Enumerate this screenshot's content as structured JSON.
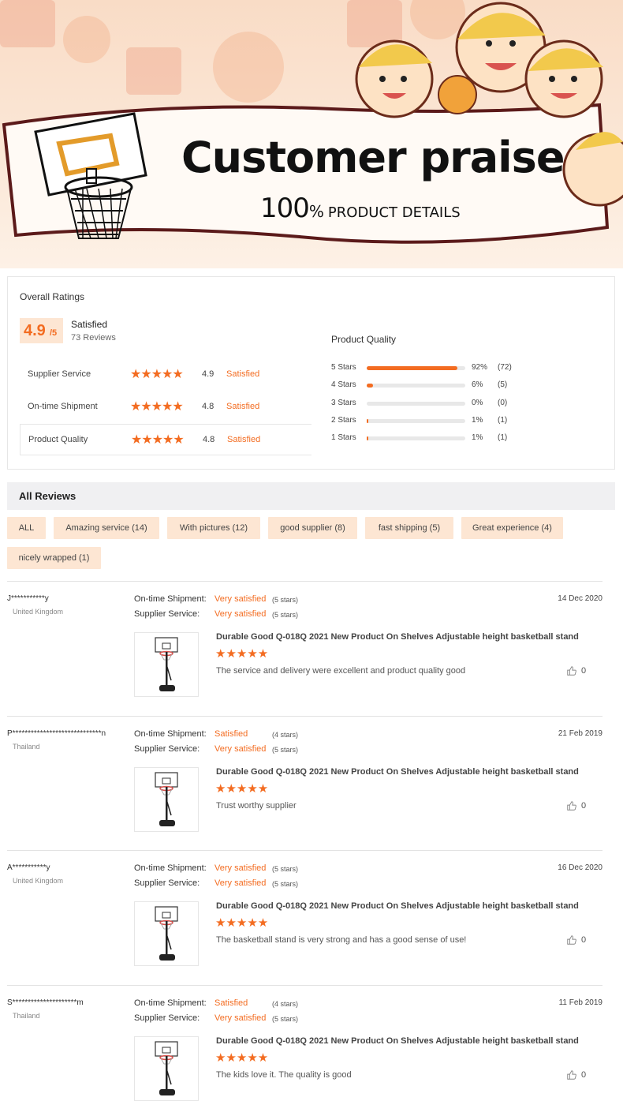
{
  "banner": {
    "title": "Customer praise",
    "percent": "100",
    "percent_sign": "%",
    "subtitle": "PRODUCT DETAILS"
  },
  "ratings": {
    "heading": "Overall Ratings",
    "score": "4.9",
    "score_suffix": "/5",
    "score_label": "Satisfied",
    "review_count": "73 Reviews",
    "rows": [
      {
        "label": "Supplier Service",
        "stars": 5,
        "value": "4.9",
        "word": "Satisfied"
      },
      {
        "label": "On-time Shipment",
        "stars": 5,
        "value": "4.8",
        "word": "Satisfied"
      },
      {
        "label": "Product Quality",
        "stars": 5,
        "value": "4.8",
        "word": "Satisfied"
      }
    ],
    "quality_title": "Product Quality",
    "distribution": [
      {
        "label": "5 Stars",
        "percent": "92%",
        "count": "(72)",
        "fraction": 0.92
      },
      {
        "label": "4 Stars",
        "percent": "6%",
        "count": "(5)",
        "fraction": 0.06
      },
      {
        "label": "3 Stars",
        "percent": "0%",
        "count": "(0)",
        "fraction": 0.0
      },
      {
        "label": "2 Stars",
        "percent": "1%",
        "count": "(1)",
        "fraction": 0.01
      },
      {
        "label": "1 Stars",
        "percent": "1%",
        "count": "(1)",
        "fraction": 0.01
      }
    ]
  },
  "reviews_section": {
    "heading": "All Reviews",
    "filters": [
      "ALL",
      "Amazing service (14)",
      "With pictures (12)",
      "good supplier (8)",
      "fast shipping (5)",
      "Great experience (4)",
      "nicely wrapped (1)"
    ]
  },
  "reviews": [
    {
      "user": "J***********y",
      "country": "United Kingdom",
      "date": "14 Dec 2020",
      "shipment_label": "On-time Shipment:",
      "shipment_value": "Very satisfied",
      "shipment_stars": "(5 stars)",
      "service_label": "Supplier Service:",
      "service_value": "Very satisfied",
      "service_stars": "(5 stars)",
      "product": "Durable Good Q-018Q 2021 New Product On Shelves Adjustable height basketball stand",
      "rating": 5,
      "text": "The service and delivery were excellent and product quality good",
      "likes": "0"
    },
    {
      "user": "P*****************************n",
      "country": "Thailand",
      "date": "21 Feb 2019",
      "shipment_label": "On-time Shipment:",
      "shipment_value": "Satisfied",
      "shipment_stars": "(4 stars)",
      "service_label": "Supplier Service:",
      "service_value": "Very satisfied",
      "service_stars": "(5 stars)",
      "product": "Durable Good Q-018Q 2021 New Product On Shelves Adjustable height basketball stand",
      "rating": 5,
      "text": "Trust worthy supplier",
      "likes": "0"
    },
    {
      "user": "A***********y",
      "country": "United Kingdom",
      "date": "16 Dec 2020",
      "shipment_label": "On-time Shipment:",
      "shipment_value": "Very satisfied",
      "shipment_stars": "(5 stars)",
      "service_label": "Supplier Service:",
      "service_value": "Very satisfied",
      "service_stars": "(5 stars)",
      "product": "Durable Good Q-018Q 2021 New Product On Shelves Adjustable height basketball stand",
      "rating": 5,
      "text": "The basketball stand is very strong and has a good sense of use!",
      "likes": "0"
    },
    {
      "user": "S*********************m",
      "country": "Thailand",
      "date": "11 Feb 2019",
      "shipment_label": "On-time Shipment:",
      "shipment_value": "Satisfied",
      "shipment_stars": "(4 stars)",
      "service_label": "Supplier Service:",
      "service_value": "Very satisfied",
      "service_stars": "(5 stars)",
      "product": "Durable Good Q-018Q 2021 New Product On Shelves Adjustable height basketball stand",
      "rating": 5,
      "text": "The kids love it. The quality is good",
      "likes": "0"
    }
  ],
  "colors": {
    "accent": "#f36c21",
    "chip_bg": "#fde6d3"
  }
}
